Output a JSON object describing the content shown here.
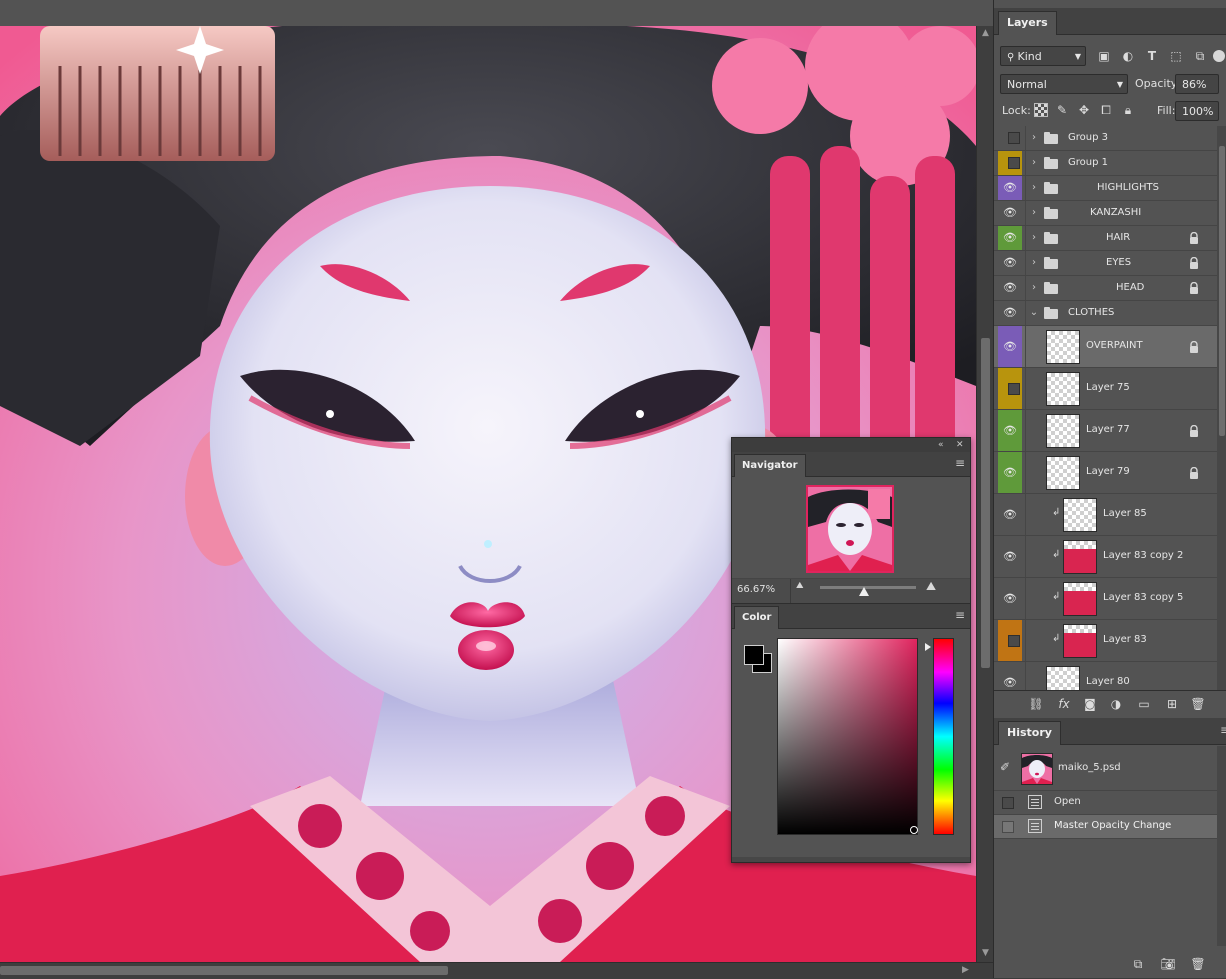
{
  "layers_panel": {
    "tab": "Layers",
    "filter_kind": "Kind",
    "blend_mode": "Normal",
    "opacity_label": "Opacity:",
    "opacity_value": "86%",
    "lock_label": "Lock:",
    "fill_label": "Fill:",
    "fill_value": "100%",
    "layers": [
      {
        "name": "Group 3",
        "type": "group",
        "visible": false,
        "color": "",
        "locked": false
      },
      {
        "name": "Group 1",
        "type": "group",
        "visible": false,
        "color": "#b8940d",
        "locked": false
      },
      {
        "name": "HIGHLIGHTS",
        "type": "group",
        "visible": true,
        "color": "#7a5cb7",
        "locked": false
      },
      {
        "name": "KANZASHI",
        "type": "group",
        "visible": true,
        "color": "",
        "locked": false
      },
      {
        "name": "HAIR",
        "type": "group",
        "visible": true,
        "color": "#5f9a3a",
        "locked": true
      },
      {
        "name": "EYES",
        "type": "group",
        "visible": true,
        "color": "",
        "locked": true
      },
      {
        "name": "HEAD",
        "type": "group",
        "visible": true,
        "color": "",
        "locked": true
      },
      {
        "name": "CLOTHES",
        "type": "group-open",
        "visible": true,
        "color": "",
        "locked": false
      },
      {
        "name": "OVERPAINT",
        "type": "layer",
        "visible": true,
        "color": "#7a5cb7",
        "locked": true,
        "selected": true
      },
      {
        "name": "Layer 75",
        "type": "layer",
        "visible": false,
        "color": "#b8940d",
        "locked": false
      },
      {
        "name": "Layer 77",
        "type": "layer",
        "visible": true,
        "color": "#5f9a3a",
        "locked": true
      },
      {
        "name": "Layer 79",
        "type": "layer",
        "visible": true,
        "color": "#5f9a3a",
        "locked": true
      },
      {
        "name": "Layer 85",
        "type": "clipped",
        "visible": true,
        "color": "",
        "locked": false
      },
      {
        "name": "Layer 83 copy 2",
        "type": "clipped",
        "visible": true,
        "color": "",
        "locked": false
      },
      {
        "name": "Layer 83 copy 5",
        "type": "clipped",
        "visible": true,
        "color": "",
        "locked": false
      },
      {
        "name": "Layer 83",
        "type": "clipped",
        "visible": false,
        "color": "#c07414",
        "locked": false
      },
      {
        "name": "Layer 80",
        "type": "layer",
        "visible": true,
        "color": "",
        "locked": false
      }
    ]
  },
  "history_panel": {
    "tab": "History",
    "snapshot": "maiko_5.psd",
    "states": [
      "Open",
      "Master Opacity Change"
    ]
  },
  "navigator": {
    "tab": "Navigator",
    "zoom": "66.67%"
  },
  "color_panel": {
    "tab": "Color",
    "foreground": "#000000",
    "background": "#000000",
    "hue_color": "#e0245e"
  }
}
